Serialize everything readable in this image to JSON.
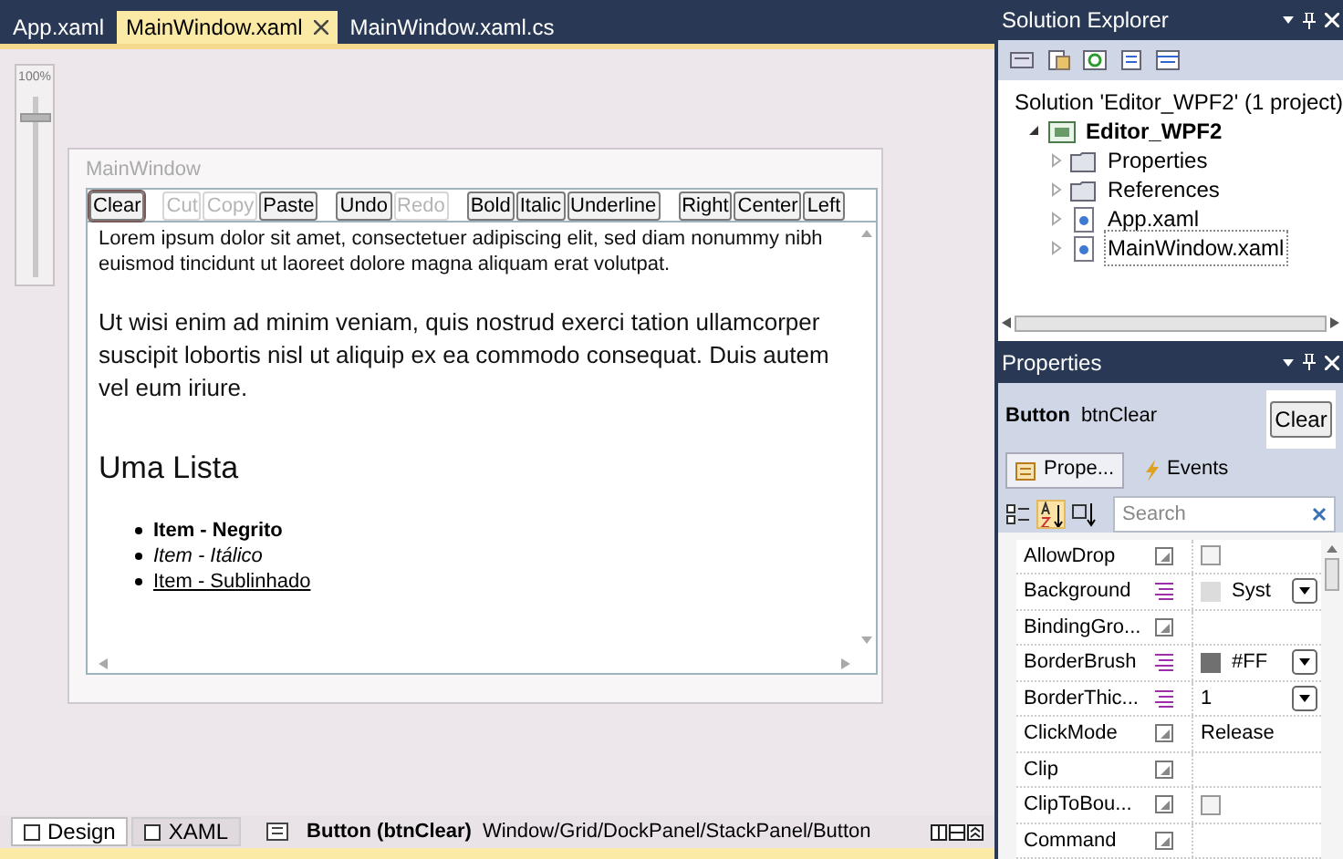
{
  "document_tabs": [
    {
      "label": "App.xaml",
      "selected": false,
      "closable": false
    },
    {
      "label": "MainWindow.xaml",
      "selected": true,
      "closable": true
    },
    {
      "label": "MainWindow.xaml.cs",
      "selected": false,
      "closable": false
    }
  ],
  "zoom": {
    "label": "100%",
    "level": 0.85
  },
  "design_window": {
    "title": "MainWindow",
    "toolbar_groups": [
      [
        {
          "label": "Clear",
          "enabled": true,
          "selected": true
        }
      ],
      [
        {
          "label": "Cut",
          "enabled": false,
          "selected": false
        },
        {
          "label": "Copy",
          "enabled": false,
          "selected": false
        },
        {
          "label": "Paste",
          "enabled": true,
          "selected": false
        }
      ],
      [
        {
          "label": "Undo",
          "enabled": true,
          "selected": false
        },
        {
          "label": "Redo",
          "enabled": false,
          "selected": false
        }
      ],
      [
        {
          "label": "Bold",
          "enabled": true,
          "selected": false
        },
        {
          "label": "Italic",
          "enabled": true,
          "selected": false
        },
        {
          "label": "Underline",
          "enabled": true,
          "selected": false
        }
      ],
      [
        {
          "label": "Right",
          "enabled": true,
          "selected": false
        },
        {
          "label": "Center",
          "enabled": true,
          "selected": false
        },
        {
          "label": "Left",
          "enabled": true,
          "selected": false
        }
      ]
    ],
    "document": [
      {
        "kind": "small",
        "text": "Lorem ipsum dolor sit amet, consectetuer adipiscing elit, sed diam nonummy nibh euismod tincidunt ut laoreet dolore magna aliquam erat volutpat."
      },
      {
        "kind": "large",
        "text": "Ut wisi enim ad minim veniam, quis nostrud exerci tation ullamcorper suscipit lobortis nisl ut aliquip ex ea commodo consequat. Duis autem vel eum iriure."
      },
      {
        "kind": "heading",
        "text": "Uma Lista"
      }
    ],
    "list_items": [
      {
        "kind": "bold",
        "text": "Item - Negrito"
      },
      {
        "kind": "italic",
        "text": "Item - Itálico"
      },
      {
        "kind": "underline",
        "text": "Item - Sublinhado"
      }
    ]
  },
  "view_tabs": [
    {
      "label": "Design",
      "selected": true
    },
    {
      "label": "XAML",
      "selected": false
    }
  ],
  "breadcrumb": {
    "element": "Button (btnClear)",
    "path": "Window/Grid/DockPanel/StackPanel/Button"
  },
  "solution_explorer": {
    "title": "Solution Explorer",
    "tree": [
      {
        "label": "Solution 'Editor_WPF2' (1 project)",
        "kind": "solution",
        "selected": false,
        "children": [
          {
            "label": "Editor_WPF2",
            "kind": "project",
            "expanded": true,
            "selected": false,
            "children": [
              {
                "label": "Properties",
                "kind": "folder",
                "expanded": false,
                "selected": false
              },
              {
                "label": "References",
                "kind": "folder",
                "expanded": false,
                "selected": false
              },
              {
                "label": "App.xaml",
                "kind": "file",
                "expanded": false,
                "selected": false
              },
              {
                "label": "MainWindow.xaml",
                "kind": "file",
                "expanded": false,
                "selected": true
              }
            ]
          }
        ]
      }
    ]
  },
  "properties": {
    "title": "Properties",
    "type": "Button",
    "name": "btnClear",
    "preview": "Clear",
    "tabs": [
      {
        "label": "Prope...",
        "selected": true
      },
      {
        "label": "Events",
        "selected": false
      }
    ],
    "search": {
      "placeholder": "Search"
    },
    "rows": [
      {
        "name": "AllowDrop",
        "set": false,
        "kind": "checkbox",
        "checked": false
      },
      {
        "name": "Background",
        "set": true,
        "kind": "brush",
        "color": "#dcdcdc",
        "value": "Syst"
      },
      {
        "name": "BindingGro...",
        "set": false,
        "kind": "empty"
      },
      {
        "name": "BorderBrush",
        "set": true,
        "kind": "brush",
        "color": "#707070",
        "value": "#FF"
      },
      {
        "name": "BorderThic...",
        "set": true,
        "kind": "dropdown",
        "value": "1"
      },
      {
        "name": "ClickMode",
        "set": false,
        "kind": "text",
        "value": "Release"
      },
      {
        "name": "Clip",
        "set": false,
        "kind": "empty"
      },
      {
        "name": "ClipToBou...",
        "set": false,
        "kind": "checkbox",
        "checked": false
      },
      {
        "name": "Command",
        "set": false,
        "kind": "empty"
      }
    ]
  }
}
